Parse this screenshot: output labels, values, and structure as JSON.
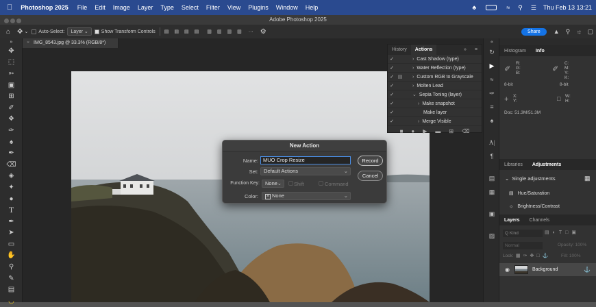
{
  "menubar": {
    "apple": "",
    "app": "Photoshop 2025",
    "items": [
      "File",
      "Edit",
      "Image",
      "Layer",
      "Type",
      "Select",
      "Filter",
      "View",
      "Plugins",
      "Window",
      "Help"
    ],
    "datetime": "Thu Feb 13  13:21"
  },
  "window": {
    "title": "Adobe Photoshop 2025"
  },
  "options": {
    "auto_select": "Auto-Select:",
    "layer_select": "Layer",
    "transform": "Show Transform Controls",
    "share": "Share",
    "more": "···"
  },
  "doc": {
    "tab": "IMG_8543.jpg @ 33.3% (RGB/8*)"
  },
  "actions_panel": {
    "tabs": [
      "History",
      "Actions"
    ],
    "items": [
      {
        "label": "Cast Shadow (type)",
        "indent": 1
      },
      {
        "label": "Water Reflection (type)",
        "indent": 1
      },
      {
        "label": "Custom RGB to Grayscale",
        "indent": 1
      },
      {
        "label": "Molten Lead",
        "indent": 1
      },
      {
        "label": "Sepia Toning (layer)",
        "indent": 1
      },
      {
        "label": "Make snapshot",
        "indent": 2
      },
      {
        "label": "Make layer",
        "indent": 2
      },
      {
        "label": "Merge Visible",
        "indent": 2
      }
    ]
  },
  "dialog": {
    "title": "New Action",
    "name_label": "Name:",
    "name_value": "MUO Crop Resize",
    "set_label": "Set:",
    "set_value": "Default Actions",
    "fkey_label": "Function Key:",
    "fkey_value": "None",
    "shift": "Shift",
    "command": "Command",
    "color_label": "Color:",
    "color_value": "None",
    "record": "Record",
    "cancel": "Cancel"
  },
  "info_panel": {
    "tabs": [
      "Histogram",
      "Info"
    ],
    "rgb": [
      "R:",
      "G:",
      "B:"
    ],
    "cmyk": [
      "C:",
      "M:",
      "Y:",
      "K:"
    ],
    "bit1": "8-bit",
    "bit2": "8-bit",
    "xy": [
      "X:",
      "Y:"
    ],
    "wh": [
      "W:",
      "H:"
    ],
    "doc": "Doc: 51.3M/51.3M"
  },
  "adjust_panel": {
    "tabs": [
      "Libraries",
      "Adjustments"
    ],
    "group": "Single adjustments",
    "items": [
      "Hue/Saturation",
      "Brightness/Contrast"
    ]
  },
  "layers_panel": {
    "tabs": [
      "Layers",
      "Channels"
    ],
    "kind": "Q Kind",
    "blend": "Normal",
    "opacity": "Opacity: 100%",
    "lock": "Lock:",
    "fill": "Fill: 100%",
    "layer": "Background"
  }
}
